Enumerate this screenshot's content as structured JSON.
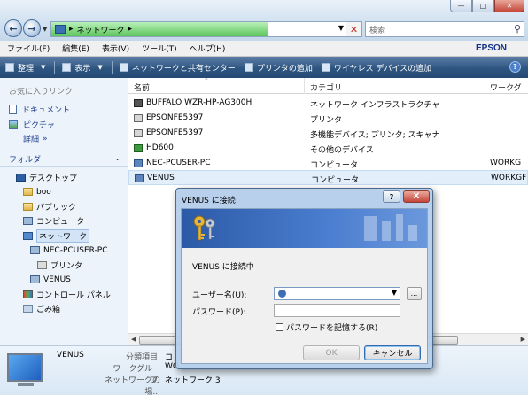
{
  "address": {
    "location": "ネットワーク",
    "progress_fraction": 0.7
  },
  "search": {
    "placeholder": "検索"
  },
  "menu": {
    "items": [
      "ファイル(F)",
      "編集(E)",
      "表示(V)",
      "ツール(T)",
      "ヘルプ(H)"
    ],
    "brand": "EPSON"
  },
  "toolbar": {
    "organize": "整理",
    "views": "表示",
    "network_center": "ネットワークと共有センター",
    "add_printer": "プリンタの追加",
    "add_wireless": "ワイヤレス デバイスの追加"
  },
  "nav": {
    "favorites_heading": "お気に入りリンク",
    "documents": "ドキュメント",
    "pictures": "ピクチャ",
    "more": "詳細",
    "folders": "フォルダ",
    "tree": [
      {
        "label": "デスクトップ",
        "icon": "desktop-icon"
      },
      {
        "label": "boo",
        "icon": "folder-icon"
      },
      {
        "label": "パブリック",
        "icon": "folder-icon"
      },
      {
        "label": "コンピュータ",
        "icon": "computer-icon"
      },
      {
        "label": "ネットワーク",
        "icon": "network-icon"
      },
      {
        "label": "NEC-PCUSER-PC",
        "icon": "computer-icon"
      },
      {
        "label": "プリンタ",
        "icon": "printer-icon"
      },
      {
        "label": "VENUS",
        "icon": "computer-icon"
      },
      {
        "label": "コントロール パネル",
        "icon": "control-panel-icon"
      },
      {
        "label": "ごみ箱",
        "icon": "recycle-bin-icon"
      }
    ]
  },
  "list": {
    "columns": [
      "名前",
      "カテゴリ",
      "ワークグ"
    ],
    "rows": [
      {
        "name": "BUFFALO WZR-HP-AG300H",
        "category": "ネットワーク インフラストラクチャ",
        "workgroup": "",
        "icon": "router-icon"
      },
      {
        "name": "EPSONFE5397",
        "category": "プリンタ",
        "workgroup": "",
        "icon": "printer-icon"
      },
      {
        "name": "EPSONFE5397",
        "category": "多機能デバイス; プリンタ; スキャナ",
        "workgroup": "",
        "icon": "printer-icon"
      },
      {
        "name": "HD600",
        "category": "その他のデバイス",
        "workgroup": "",
        "icon": "media-device-icon"
      },
      {
        "name": "NEC-PCUSER-PC",
        "category": "コンピュータ",
        "workgroup": "WORKG",
        "icon": "computer-icon"
      },
      {
        "name": "VENUS",
        "category": "コンピュータ",
        "workgroup": "WORKGF",
        "icon": "computer-icon"
      }
    ]
  },
  "details": {
    "name": "VENUS",
    "category_label": "分類項目:",
    "category_value": "コ",
    "workgroup_label": "ワークグループ:",
    "workgroup_value": "WO",
    "network_label": "ネットワークの場...",
    "network_value": "ネットワーク 3"
  },
  "dialog": {
    "title": "VENUS に接続",
    "help": "?",
    "close": "X",
    "connecting": "VENUS に接続中",
    "username_label": "ユーザー名(U):",
    "password_label": "パスワード(P):",
    "browse": "...",
    "remember": "パスワードを記憶する(R)",
    "ok": "OK",
    "cancel": "キャンセル"
  }
}
